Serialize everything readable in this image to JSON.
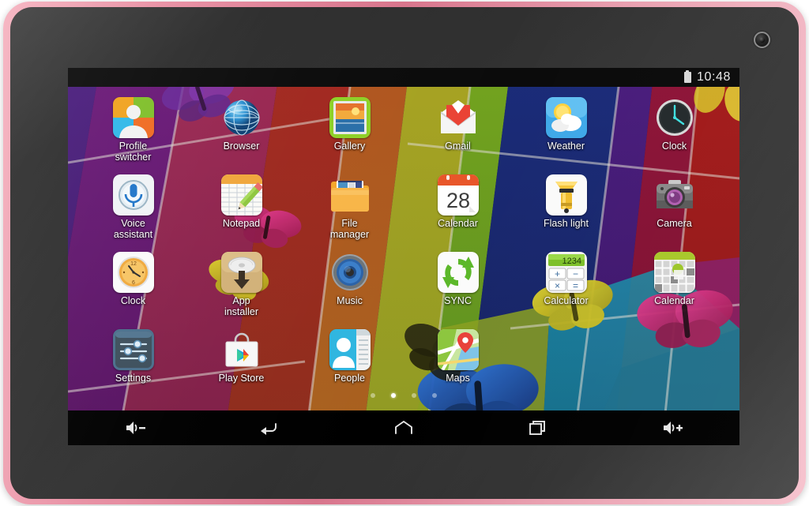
{
  "device": {
    "shell_color": "#e08ea1",
    "bezel_color": "#303030",
    "camera_name": "front-camera"
  },
  "status_bar": {
    "clock": "10:48",
    "battery_icon": "battery-icon"
  },
  "home_screen": {
    "page_dots": {
      "count": 4,
      "active_index": 1
    },
    "apps": [
      {
        "label": "Profile\nswitcher",
        "icon": "profile-switcher-icon"
      },
      {
        "label": "Browser",
        "icon": "browser-globe-icon"
      },
      {
        "label": "Gallery",
        "icon": "gallery-icon"
      },
      {
        "label": "Gmail",
        "icon": "gmail-icon"
      },
      {
        "label": "Weather",
        "icon": "weather-icon"
      },
      {
        "label": "Clock",
        "icon": "clock-analog-icon"
      },
      {
        "label": "Voice\nassistant",
        "icon": "voice-assistant-mic-icon"
      },
      {
        "label": "Notepad",
        "icon": "notepad-icon"
      },
      {
        "label": "File\nmanager",
        "icon": "file-manager-folder-icon"
      },
      {
        "label": "Calendar",
        "icon": "calendar-28-icon",
        "badge": "28"
      },
      {
        "label": "Flash light",
        "icon": "flashlight-icon"
      },
      {
        "label": "Camera",
        "icon": "camera-icon"
      },
      {
        "label": "Clock",
        "icon": "clock-face-icon",
        "marks": [
          "12",
          "6"
        ]
      },
      {
        "label": "App\ninstaller",
        "icon": "app-installer-icon"
      },
      {
        "label": "Music",
        "icon": "music-speaker-icon"
      },
      {
        "label": "SYNC",
        "icon": "sync-arrows-icon"
      },
      {
        "label": "Calculator",
        "icon": "calculator-icon",
        "display": "1234",
        "keys": [
          "+",
          "−",
          "×",
          "="
        ]
      },
      {
        "label": "Calendar",
        "icon": "calendar-grid-icon"
      },
      {
        "label": "Settings",
        "icon": "settings-sliders-icon"
      },
      {
        "label": "Play Store",
        "icon": "play-store-icon"
      },
      {
        "label": "People",
        "icon": "people-contact-icon"
      },
      {
        "label": "Maps",
        "icon": "maps-pin-icon"
      },
      {
        "label": "",
        "icon": ""
      },
      {
        "label": "",
        "icon": ""
      }
    ]
  },
  "nav_bar": {
    "buttons": [
      {
        "name": "volume-down-button",
        "icon": "volume-down-icon"
      },
      {
        "name": "back-button",
        "icon": "back-arrow-icon"
      },
      {
        "name": "home-button",
        "icon": "home-icon"
      },
      {
        "name": "recents-button",
        "icon": "recents-icon"
      },
      {
        "name": "volume-up-button",
        "icon": "volume-up-icon"
      }
    ]
  }
}
